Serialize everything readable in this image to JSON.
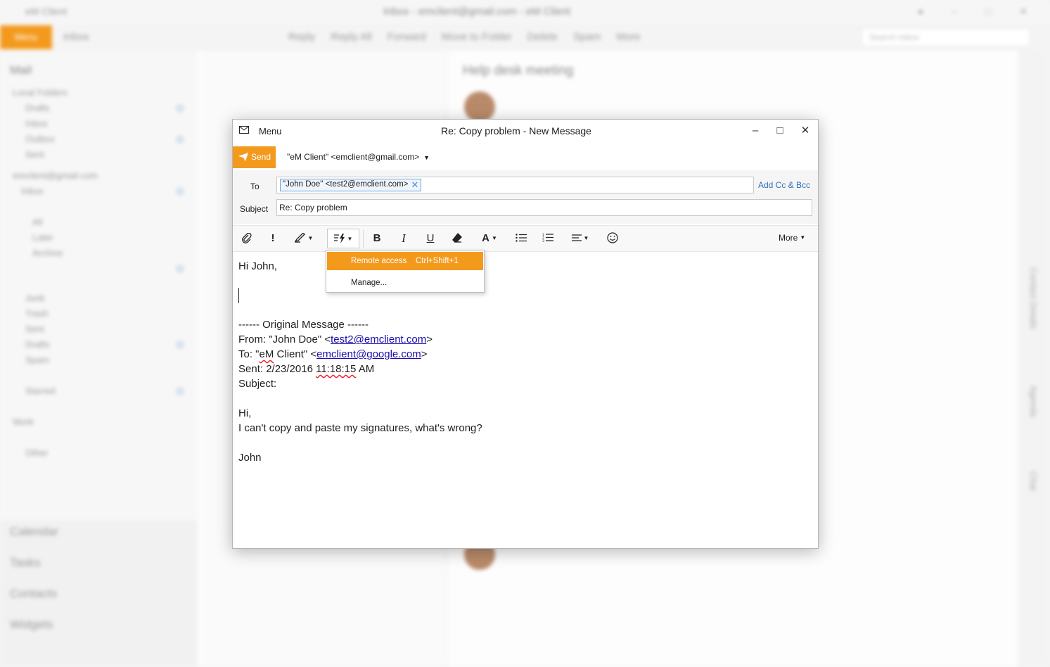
{
  "background": {
    "app_name": "eM Client",
    "window_title": "Inbox - emclient@gmail.com - eM Client",
    "menu_label": "Menu",
    "tab_label": "Inbox",
    "toolbar_items": [
      "Reply",
      "Reply All",
      "Forward",
      "Move to Folder",
      "Delete",
      "Spam",
      "More"
    ],
    "search_placeholder": "Search Inbox",
    "sidebar_title": "Mail",
    "folders": [
      "Local Folders",
      "Drafts",
      "Inbox",
      "Outbox",
      "Sent",
      "emclient@gmail.com",
      "Inbox",
      "All",
      "Later",
      "Archive",
      "Junk",
      "Trash",
      "Sent",
      "Drafts",
      "Spam",
      "Starred",
      "Work",
      "Other"
    ],
    "nav_items": [
      "Calendar",
      "Tasks",
      "Contacts",
      "Widgets"
    ],
    "reading_title": "Help desk meeting",
    "rail_items": [
      "Contact Details",
      "Agenda",
      "Chat"
    ]
  },
  "compose": {
    "menu_label": "Menu",
    "title": "Re: Copy problem - New Message",
    "send_label": "Send",
    "from": "\"eM Client\" <emclient@gmail.com>",
    "to_label": "To",
    "recipient": "\"John Doe\" <test2@emclient.com>",
    "add_cc_bcc": "Add Cc & Bcc",
    "subject_label": "Subject",
    "subject_value": "Re: Copy problem",
    "more_label": "More",
    "body": {
      "greeting": "Hi John,",
      "original_header": "------ Original Message ------",
      "from_prefix": "From: \"John Doe\" <",
      "from_email": "test2@emclient.com",
      "to_prefix_1": "To: \"",
      "to_prefix_em": "eM",
      "to_prefix_2": " Client\" <",
      "to_email": "emclient@google.com",
      "sent_prefix": "Sent: 2/23/2016 ",
      "sent_time": "11:18:15",
      "sent_suffix": " AM",
      "subject_line": "Subject:",
      "hi": "Hi,",
      "message": "I can't copy and paste my signatures, what's wrong?",
      "signoff": "John",
      "close_bracket": ">"
    }
  },
  "dropdown": {
    "items": [
      {
        "label": "Remote access",
        "shortcut": "Ctrl+Shift+1",
        "highlighted": true
      },
      {
        "label": "Manage...",
        "shortcut": "",
        "highlighted": false
      }
    ]
  },
  "colors": {
    "accent": "#f39a1d",
    "link": "#1a0dab",
    "chip_border": "#6fa1d6"
  }
}
